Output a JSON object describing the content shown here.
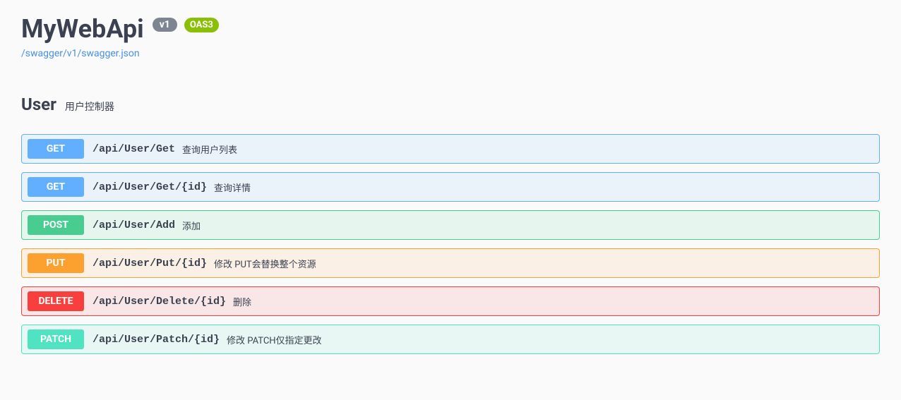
{
  "header": {
    "title": "MyWebApi",
    "version": "v1",
    "oas": "OAS3",
    "json_link": "/swagger/v1/swagger.json"
  },
  "tag": {
    "name": "User",
    "description": "用户控制器"
  },
  "operations": [
    {
      "method": "GET",
      "method_class": "get",
      "path": "/api/User/Get",
      "summary": "查询用户列表"
    },
    {
      "method": "GET",
      "method_class": "get",
      "path": "/api/User/Get/{id}",
      "summary": "查询详情"
    },
    {
      "method": "POST",
      "method_class": "post",
      "path": "/api/User/Add",
      "summary": "添加"
    },
    {
      "method": "PUT",
      "method_class": "put",
      "path": "/api/User/Put/{id}",
      "summary": "修改 PUT会替换整个资源"
    },
    {
      "method": "DELETE",
      "method_class": "delete",
      "path": "/api/User/Delete/{id}",
      "summary": "删除"
    },
    {
      "method": "PATCH",
      "method_class": "patch",
      "path": "/api/User/Patch/{id}",
      "summary": "修改 PATCH仅指定更改"
    }
  ]
}
